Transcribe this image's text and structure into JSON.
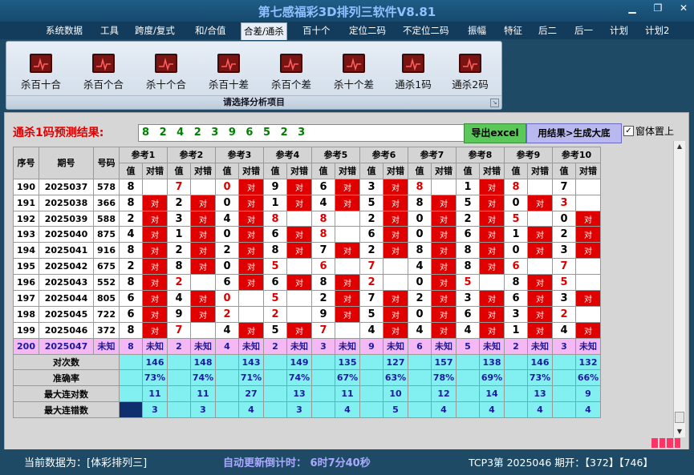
{
  "window": {
    "title": "第七感福彩3D排列三软件V8.81",
    "minimize": "▁",
    "restore": "❐",
    "close": "✕"
  },
  "menu": [
    "系统数据",
    "工具",
    "跨度/复式",
    "和/合值",
    "合差/通杀",
    "百十个",
    "定位二码",
    "不定位二码",
    "振幅",
    "特征",
    "后二",
    "后一",
    "计划",
    "计划2"
  ],
  "active_menu": "合差/通杀",
  "ribbon": {
    "buttons": [
      "杀百十合",
      "杀百个合",
      "杀十个合",
      "杀百十差",
      "杀百个差",
      "杀十个差",
      "通杀1码",
      "通杀2码"
    ],
    "footer": "请选择分析项目"
  },
  "prediction": {
    "label": "通杀1码预测结果:",
    "value": "8 2 4 2 3 9 6 5 2 3",
    "export_button": "导出excel",
    "generate_button": "用结果>生成大底",
    "topmost_label": "窗体置上",
    "topmost_checked": "✓"
  },
  "table": {
    "headers": {
      "seq": "序号",
      "issue": "期号",
      "number": "号码",
      "value": "值",
      "correct": "对错"
    },
    "refs": [
      "参考1",
      "参考2",
      "参考3",
      "参考4",
      "参考5",
      "参考6",
      "参考7",
      "参考8",
      "参考9",
      "参考10"
    ],
    "hit_text": "对",
    "rows": [
      {
        "seq": "190",
        "issue": "2025037",
        "number": "578",
        "vals": [
          "8",
          "7",
          "0",
          "9",
          "6",
          "3",
          "8",
          "1",
          "8",
          "7"
        ],
        "hits": [
          0,
          0,
          1,
          1,
          1,
          1,
          0,
          1,
          0,
          0
        ]
      },
      {
        "seq": "191",
        "issue": "2025038",
        "number": "366",
        "vals": [
          "8",
          "2",
          "0",
          "1",
          "4",
          "5",
          "8",
          "5",
          "0",
          "3"
        ],
        "hits": [
          1,
          1,
          1,
          1,
          1,
          1,
          1,
          1,
          1,
          0
        ]
      },
      {
        "seq": "192",
        "issue": "2025039",
        "number": "588",
        "vals": [
          "2",
          "3",
          "4",
          "8",
          "8",
          "2",
          "0",
          "2",
          "5",
          "0"
        ],
        "hits": [
          1,
          1,
          1,
          0,
          0,
          1,
          1,
          1,
          0,
          1
        ]
      },
      {
        "seq": "193",
        "issue": "2025040",
        "number": "875",
        "vals": [
          "4",
          "1",
          "0",
          "6",
          "8",
          "6",
          "0",
          "6",
          "1",
          "2"
        ],
        "hits": [
          1,
          1,
          1,
          1,
          0,
          1,
          1,
          1,
          1,
          1
        ]
      },
      {
        "seq": "194",
        "issue": "2025041",
        "number": "916",
        "vals": [
          "8",
          "2",
          "2",
          "8",
          "7",
          "2",
          "8",
          "8",
          "0",
          "3"
        ],
        "hits": [
          1,
          1,
          1,
          1,
          1,
          1,
          1,
          1,
          1,
          1
        ]
      },
      {
        "seq": "195",
        "issue": "2025042",
        "number": "675",
        "vals": [
          "2",
          "8",
          "0",
          "5",
          "6",
          "7",
          "4",
          "8",
          "6",
          "7"
        ],
        "hits": [
          1,
          1,
          1,
          0,
          0,
          0,
          1,
          1,
          0,
          0
        ]
      },
      {
        "seq": "196",
        "issue": "2025043",
        "number": "552",
        "vals": [
          "8",
          "2",
          "6",
          "6",
          "8",
          "2",
          "0",
          "5",
          "8",
          "5"
        ],
        "hits": [
          1,
          0,
          1,
          1,
          1,
          0,
          1,
          0,
          1,
          0
        ]
      },
      {
        "seq": "197",
        "issue": "2025044",
        "number": "805",
        "vals": [
          "6",
          "4",
          "0",
          "5",
          "2",
          "7",
          "2",
          "3",
          "6",
          "3"
        ],
        "hits": [
          1,
          1,
          0,
          0,
          1,
          1,
          1,
          1,
          1,
          1
        ]
      },
      {
        "seq": "198",
        "issue": "2025045",
        "number": "722",
        "vals": [
          "6",
          "9",
          "2",
          "2",
          "9",
          "5",
          "0",
          "6",
          "3",
          "2"
        ],
        "hits": [
          1,
          1,
          0,
          0,
          1,
          1,
          1,
          1,
          1,
          0
        ]
      },
      {
        "seq": "199",
        "issue": "2025046",
        "number": "372",
        "vals": [
          "8",
          "7",
          "4",
          "5",
          "7",
          "4",
          "4",
          "4",
          "1",
          "4"
        ],
        "hits": [
          1,
          0,
          1,
          1,
          0,
          1,
          1,
          1,
          1,
          1
        ]
      },
      {
        "seq": "200",
        "issue": "2025047",
        "number": "未知",
        "vals": [
          "8",
          "2",
          "4",
          "2",
          "3",
          "9",
          "6",
          "5",
          "2",
          "3"
        ],
        "unknown": "未知"
      }
    ],
    "red_vals": [
      [
        0,
        1,
        1,
        0,
        0,
        0,
        1,
        0,
        1,
        0
      ],
      [
        0,
        0,
        0,
        0,
        0,
        0,
        0,
        0,
        0,
        1
      ],
      [
        0,
        0,
        0,
        1,
        1,
        0,
        0,
        0,
        1,
        0
      ],
      [
        0,
        0,
        0,
        0,
        1,
        0,
        0,
        0,
        0,
        0
      ],
      [
        0,
        0,
        0,
        0,
        0,
        0,
        0,
        0,
        0,
        0
      ],
      [
        0,
        0,
        0,
        1,
        1,
        1,
        0,
        0,
        1,
        1
      ],
      [
        0,
        1,
        0,
        0,
        0,
        1,
        0,
        1,
        0,
        1
      ],
      [
        0,
        0,
        1,
        1,
        0,
        0,
        0,
        0,
        0,
        0
      ],
      [
        0,
        0,
        1,
        1,
        0,
        0,
        0,
        0,
        0,
        1
      ],
      [
        0,
        1,
        0,
        0,
        1,
        0,
        0,
        0,
        0,
        0
      ]
    ],
    "stats": [
      {
        "label": "对次数",
        "values": [
          "146",
          "148",
          "143",
          "149",
          "135",
          "127",
          "157",
          "138",
          "146",
          "132"
        ]
      },
      {
        "label": "准确率",
        "values": [
          "73%",
          "74%",
          "71%",
          "74%",
          "67%",
          "63%",
          "78%",
          "69%",
          "73%",
          "66%"
        ]
      },
      {
        "label": "最大连对数",
        "values": [
          "11",
          "11",
          "27",
          "13",
          "11",
          "10",
          "12",
          "14",
          "13",
          "9"
        ]
      },
      {
        "label": "最大连错数",
        "values": [
          "3",
          "3",
          "4",
          "3",
          "4",
          "5",
          "4",
          "4",
          "4",
          "4"
        ]
      }
    ]
  },
  "status": {
    "current_data": "当前数据为：[体彩排列三]",
    "countdown": "自动更新倒计时：  6时7分40秒",
    "draw_info": "TCP3第 2025046 期开：【372】【746】"
  },
  "colors": {
    "hit": "#e00000",
    "stats_bg": "#82f0f0",
    "last_row": "#f4b8f4",
    "pred_text": "#008000",
    "red_label": "#e00000"
  }
}
